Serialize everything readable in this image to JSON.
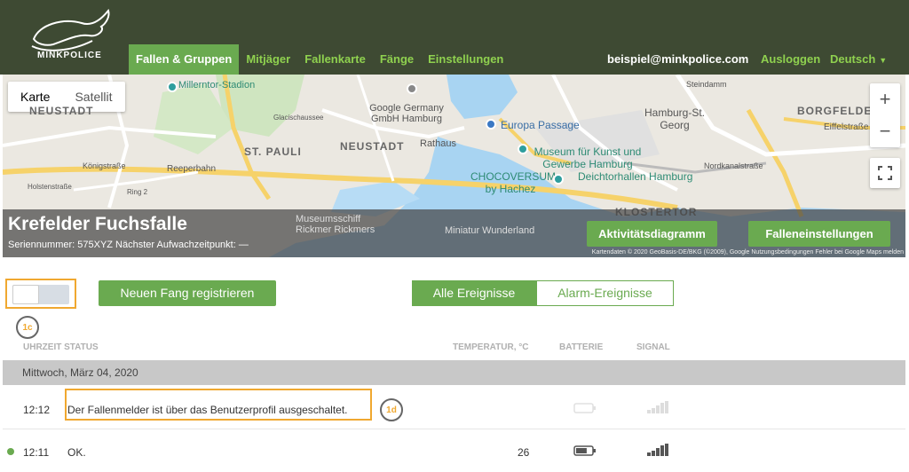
{
  "header": {
    "brand": "MINKPOLICE",
    "nav": [
      {
        "label": "Fallen & Gruppen",
        "active": true
      },
      {
        "label": "Mitjäger",
        "active": false
      },
      {
        "label": "Fallenkarte",
        "active": false
      },
      {
        "label": "Fänge",
        "active": false
      },
      {
        "label": "Einstellungen",
        "active": false
      }
    ],
    "email": "beispiel@minkpolice.com",
    "logout": "Ausloggen",
    "language": "Deutsch"
  },
  "map": {
    "type_buttons": [
      "Karte",
      "Satellit"
    ],
    "labels": {
      "millerntor": "Millerntor-Stadion",
      "neustadt_upper": "NEUSTADT",
      "google": "Google Germany GmbH Hamburg",
      "europa": "Europa Passage",
      "hbf": "Hamburg-St. Georg",
      "borgfelde": "BORGFELDE",
      "eiffel": "Eiffelstraße",
      "stpauli": "ST. PAULI",
      "neustadt": "NEUSTADT",
      "rathaus": "Rathaus",
      "museum": "Museum für Kunst und Gewerbe Hamburg",
      "choco": "CHOCOVERSUM by Hachez",
      "deich": "Deichtorhallen Hamburg",
      "reeperbahn": "Reeperbahn",
      "koenig": "Königstraße",
      "nord": "Nordkanalstraße",
      "klostertor": "KLOSTERTOR",
      "museumsschiff": "Museumsschiff Rickmer Rickmers",
      "miniatur": "Miniatur Wunderland",
      "steindamm": "Steindamm",
      "glacis": "Glacischaussee",
      "ring2": "Ring 2",
      "holsten": "Holstenstraße"
    },
    "attribution": "Kartendaten © 2020 GeoBasis-DE/BKG (©2009), Google   Nutzungsbedingungen   Fehler bei Google Maps melden"
  },
  "trap": {
    "name": "Krefelder Fuchsfalle",
    "subtitle": "Seriennummer: 575XYZ Nächster Aufwachzeitpunkt: —",
    "activity_button": "Aktivitätsdiagramm",
    "settings_button": "Falleneinstellungen"
  },
  "controls": {
    "register_button": "Neuen Fang registrieren",
    "filter_all": "Alle Ereignisse",
    "filter_alarm": "Alarm-Ereignisse",
    "annot_1c": "1c",
    "annot_1d": "1d"
  },
  "table": {
    "headers": {
      "time_status": "UHRZEIT STATUS",
      "temperature": "TEMPERATUR, °C",
      "battery": "BATTERIE",
      "signal": "SIGNAL"
    },
    "day": "Mittwoch, März 04, 2020",
    "rows": [
      {
        "time": "12:12",
        "message": "Der Fallenmelder ist über das Benutzerprofil ausgeschaltet.",
        "temperature": "",
        "battery_level": 0,
        "signal_level": 0
      },
      {
        "time": "12:11",
        "message": "OK.",
        "temperature": "26",
        "battery_level": 0.7,
        "signal_level": 1
      }
    ]
  },
  "colors": {
    "header_bg": "#3e4a33",
    "accent_green": "#6aaa50",
    "nav_green": "#8fd14f",
    "highlight_orange": "#f0a830"
  }
}
